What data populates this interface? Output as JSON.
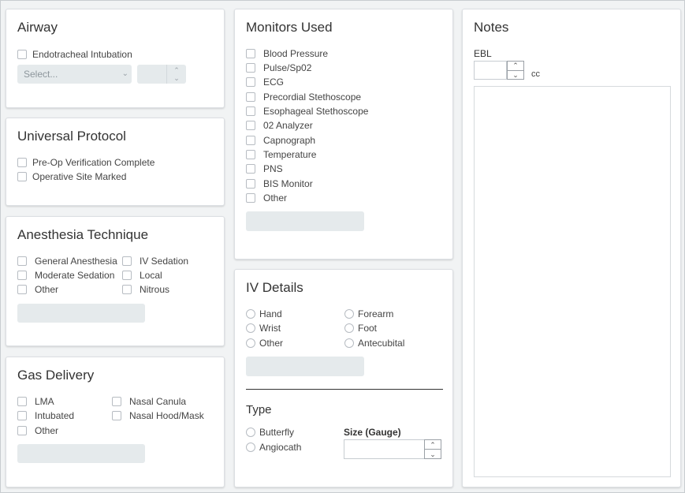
{
  "airway": {
    "title": "Airway",
    "intubation_label": "Endotracheal Intubation",
    "select_placeholder": "Select..."
  },
  "universal_protocol": {
    "title": "Universal Protocol",
    "items": [
      "Pre-Op Verification Complete",
      "Operative Site Marked"
    ]
  },
  "anesthesia_technique": {
    "title": "Anesthesia Technique",
    "col1": [
      "General Anesthesia",
      "Moderate Sedation",
      "Other"
    ],
    "col2": [
      "IV Sedation",
      "Local",
      "Nitrous"
    ]
  },
  "gas_delivery": {
    "title": "Gas Delivery",
    "col1": [
      "LMA",
      "Intubated",
      "Other"
    ],
    "col2": [
      "Nasal Canula",
      "Nasal Hood/Mask"
    ]
  },
  "monitors": {
    "title": "Monitors Used",
    "items": [
      "Blood Pressure",
      "Pulse/Sp02",
      "ECG",
      "Precordial Stethoscope",
      "Esophageal Stethoscope",
      "02 Analyzer",
      "Capnograph",
      "Temperature",
      "PNS",
      "BIS Monitor",
      "Other"
    ]
  },
  "iv_details": {
    "title": "IV Details",
    "col1": [
      "Hand",
      "Wrist",
      "Other"
    ],
    "col2": [
      "Forearm",
      "Foot",
      "Antecubital"
    ],
    "type_title": "Type",
    "types": [
      "Butterfly",
      "Angiocath"
    ],
    "size_label": "Size (Gauge)"
  },
  "notes": {
    "title": "Notes",
    "ebl_label": "EBL",
    "ebl_unit": "cc"
  }
}
